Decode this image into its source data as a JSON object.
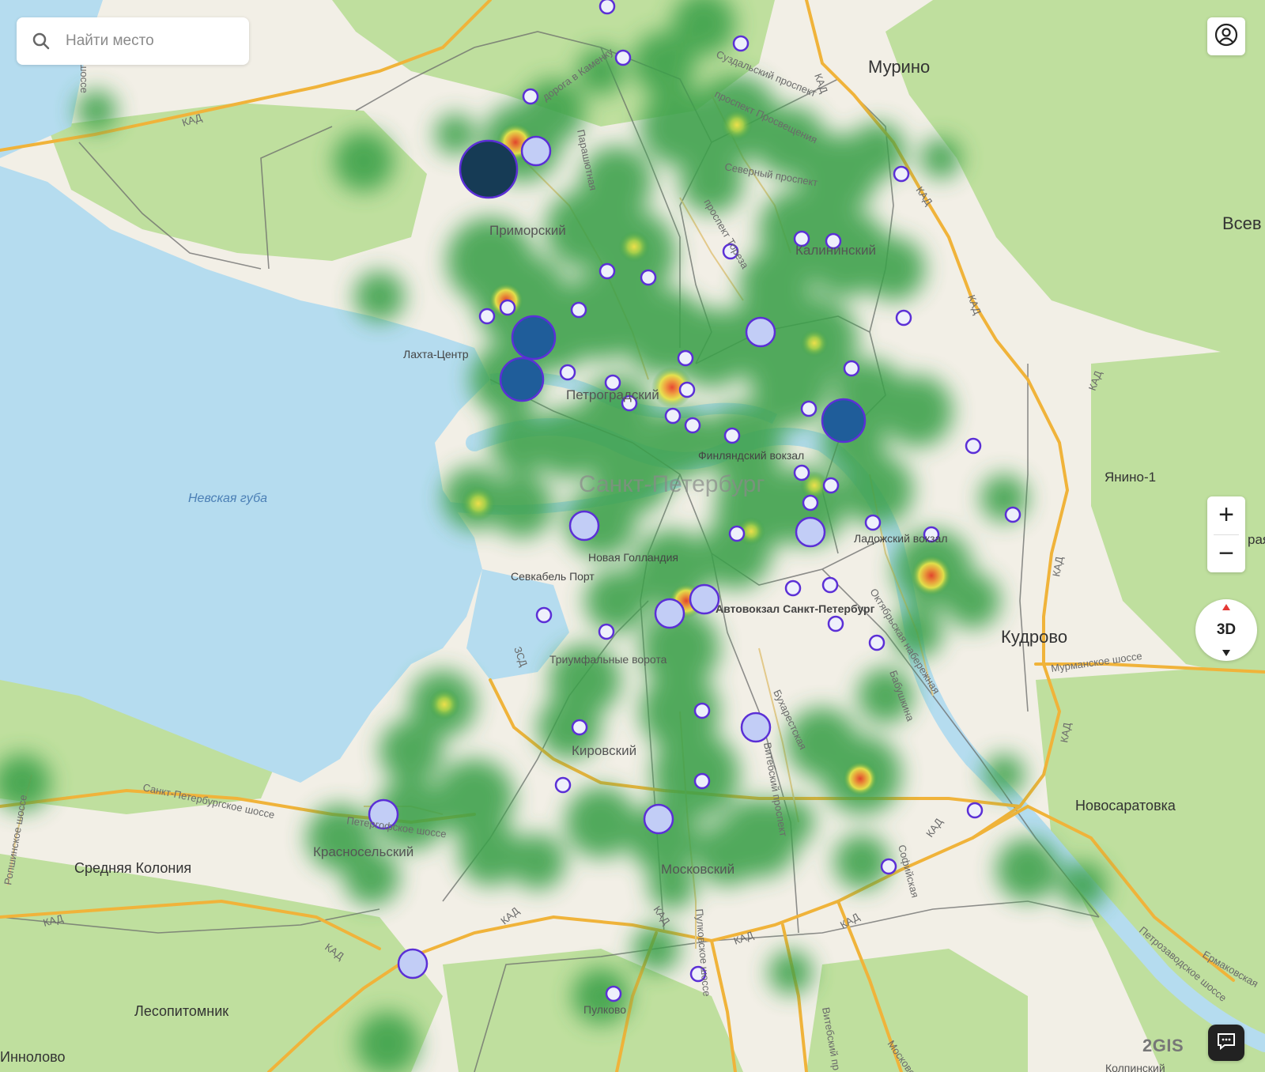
{
  "search": {
    "placeholder": "Найти место"
  },
  "controls": {
    "zoom_in": "+",
    "zoom_out": "−",
    "three_d": "3D",
    "brand": "2GIS"
  },
  "icons": [
    "search-icon",
    "profile-icon",
    "compass-icon",
    "chat-icon"
  ],
  "colors": {
    "water": "#b5dcef",
    "land": "#f2efe6",
    "forest": "#b8dc98",
    "road": "#f0b33a",
    "heat_low": "#3aa04a",
    "heat_mid": "#e8e24a",
    "heat_high": "#e8402a",
    "marker_fill": "#c2cdf6",
    "marker_stroke": "#5b2fd6",
    "marker_dark": "#1f5d9a"
  },
  "labels": {
    "places": [
      "Мурино",
      "Всев",
      "Приморский",
      "Калининский",
      "Лахта-Центр",
      "Петроградский",
      "Санкт-Петербург",
      "Финляндский вокзал",
      "Ладожский вокзал",
      "Новая Голландия",
      "Севкабель Порт",
      "Автовокзал Санкт-Петербург",
      "Триумфальные ворота",
      "Кировский",
      "Красносельский",
      "Средняя Колония",
      "Московский",
      "Лесопитомник",
      "Иннолово",
      "Пулково",
      "Новосаратовка",
      "Кудрово",
      "Янино-1",
      "Колпинский",
      "рая"
    ],
    "water": [
      "Невская губа"
    ],
    "roads": [
      "КАД",
      "Суздальский проспект",
      "проспект Просвещения",
      "Северный проспект",
      "проспект Тореза",
      "дорога в Каменку",
      "Парашютная",
      "ЗСД",
      "Октябрьская набережная",
      "Бабушкина",
      "Бухарестская",
      "Витебский проспект",
      "Софийская",
      "Пулковское шоссе",
      "Петергофское шоссе",
      "Санкт-Петербургское шоссе",
      "Ропшинское шоссе",
      "Мурманское шоссе",
      "Петрозаводское шоссе",
      "Ермаковская",
      "Витебский пр",
      "Московское",
      "шоссе"
    ]
  }
}
